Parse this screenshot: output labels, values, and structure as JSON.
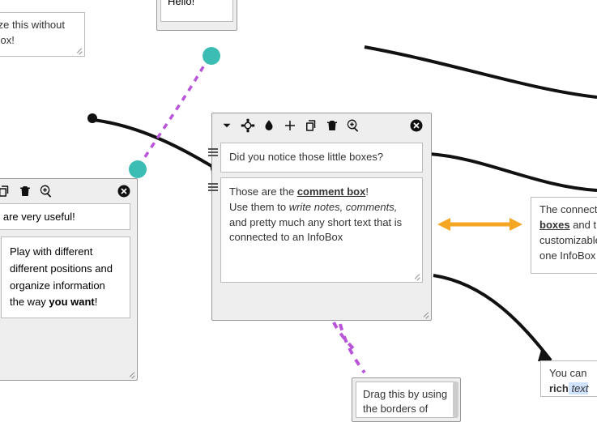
{
  "hello_note": "Hello!",
  "resize_note": "esize this without\nfoBox!",
  "left_panel": {
    "top_text": "xes are very useful!",
    "play_text_pre": "Play with different different positions and organize information the way ",
    "play_text_bold": "you want",
    "play_text_post": "!"
  },
  "center_panel": {
    "title": "Did you notice those little boxes?",
    "body_pre": "Those are the ",
    "body_bold_underline": "comment box",
    "body_exclaim": "!",
    "line2_a": "Use them to ",
    "line2_italic": "write notes, comments,",
    "line2_b": " and pretty much any short text that is connected to an InfoBox"
  },
  "right_note": {
    "l1a": "The connectors ",
    "l2a": "boxes",
    "l2b": " and the li",
    "l3": "customizable jus",
    "l4": "one InfoBox to a"
  },
  "br_note": {
    "l1": "You can ",
    "l2a": "rich",
    "l2b": " text",
    "l2c": ""
  },
  "drag_note": "Drag this by using the borders of"
}
